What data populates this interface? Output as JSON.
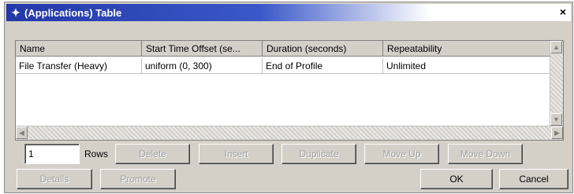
{
  "window": {
    "title": "(Applications) Table",
    "close_symbol": "×"
  },
  "table": {
    "columns": [
      "Name",
      "Start Time Offset (se...",
      "Duration (seconds)",
      "Repeatability"
    ],
    "rows": [
      [
        "File Transfer (Heavy)",
        "uniform (0, 300)",
        "End of Profile",
        "Unlimited"
      ]
    ]
  },
  "controls": {
    "rows_value": "1",
    "rows_label": "Rows",
    "delete": "Delete",
    "insert": "Insert",
    "duplicate": "Duplicate",
    "move_up": "Move Up",
    "move_down": "Move Down",
    "details": "Details",
    "promote": "Promote",
    "ok": "OK",
    "cancel": "Cancel"
  }
}
